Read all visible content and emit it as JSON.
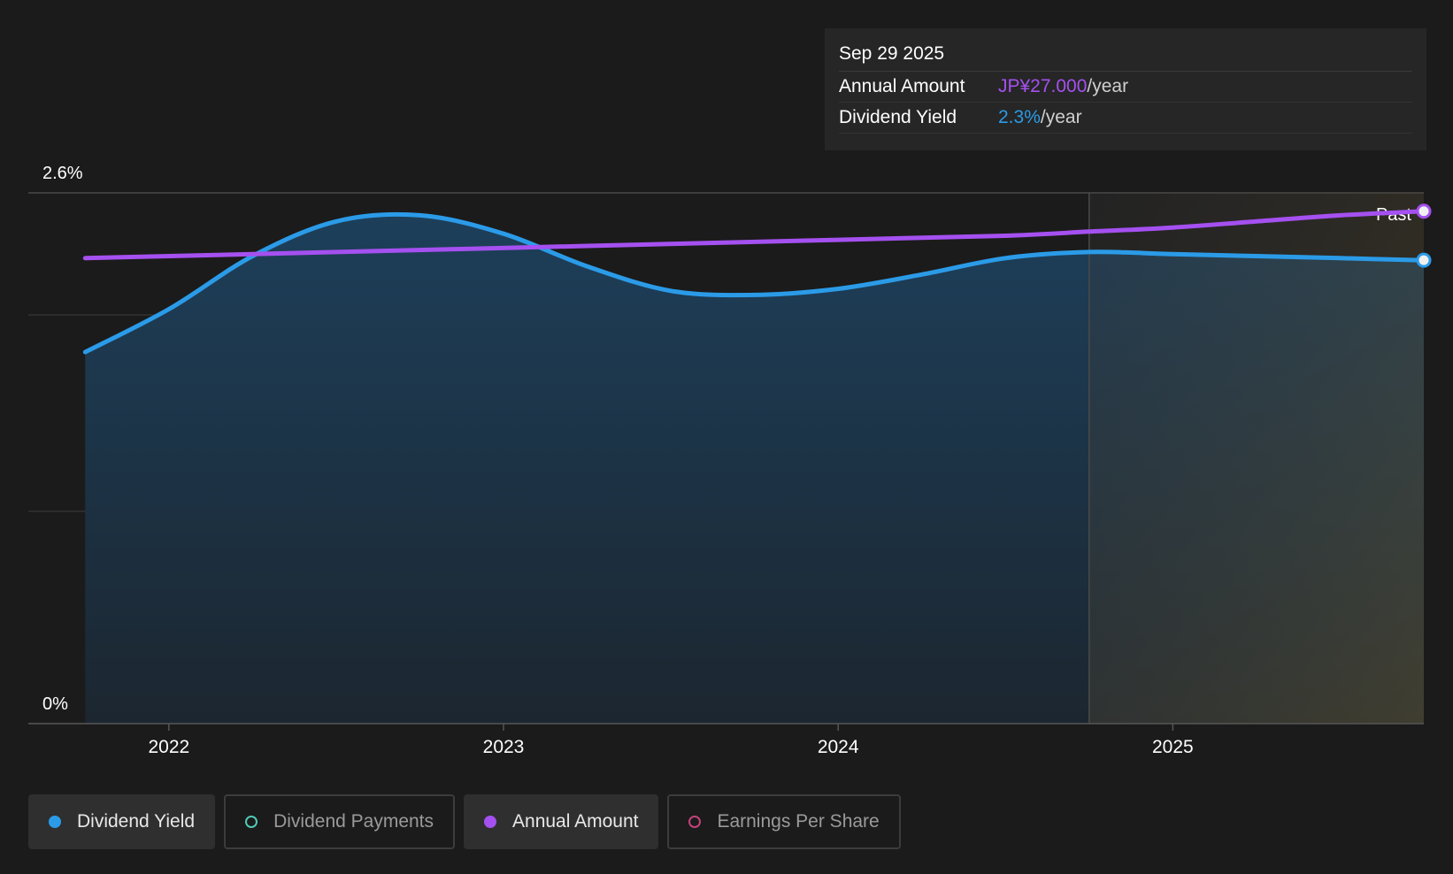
{
  "tooltip": {
    "date": "Sep 29 2025",
    "annual_amount_label": "Annual Amount",
    "annual_amount_value": "JP¥27.000",
    "annual_amount_unit": "/year",
    "dividend_yield_label": "Dividend Yield",
    "dividend_yield_value": "2.3%",
    "dividend_yield_unit": "/year"
  },
  "past_label": "Past",
  "legend": [
    {
      "label": "Dividend Yield",
      "active": true,
      "color": "#2b9be8"
    },
    {
      "label": "Dividend Payments",
      "active": false,
      "color": "#4fc9b5"
    },
    {
      "label": "Annual Amount",
      "active": true,
      "color": "#a550f0"
    },
    {
      "label": "Earnings Per Share",
      "active": false,
      "color": "#c2427a"
    }
  ],
  "colors": {
    "background": "#1b1b1b",
    "dividend_yield": "#2b9be8",
    "annual_amount": "#a550f0",
    "past_region": "#4a3f2a"
  },
  "chart_data": {
    "type": "line",
    "x_tick_labels": [
      "2022",
      "2023",
      "2024",
      "2025"
    ],
    "x_range": [
      2021.58,
      2025.75
    ],
    "y_tick_labels": [
      "0%",
      "2.6%"
    ],
    "ylim": [
      0,
      2.6
    ],
    "past_region_start": 2024.75,
    "series": [
      {
        "name": "Dividend Yield",
        "unit": "%",
        "x": [
          2021.75,
          2022.0,
          2022.25,
          2022.5,
          2022.75,
          2023.0,
          2023.25,
          2023.5,
          2023.75,
          2024.0,
          2024.25,
          2024.5,
          2024.75,
          2025.0,
          2025.25,
          2025.5,
          2025.75
        ],
        "values": [
          1.82,
          2.03,
          2.29,
          2.46,
          2.49,
          2.4,
          2.24,
          2.12,
          2.1,
          2.13,
          2.2,
          2.28,
          2.31,
          2.3,
          2.29,
          2.28,
          2.27
        ]
      },
      {
        "name": "Annual Amount",
        "x": [
          2021.75,
          2022.5,
          2023.25,
          2024.0,
          2024.5,
          2024.75,
          2025.0,
          2025.25,
          2025.5,
          2025.75
        ],
        "values": [
          2.28,
          2.31,
          2.34,
          2.37,
          2.39,
          2.41,
          2.43,
          2.46,
          2.49,
          2.51
        ]
      }
    ]
  }
}
